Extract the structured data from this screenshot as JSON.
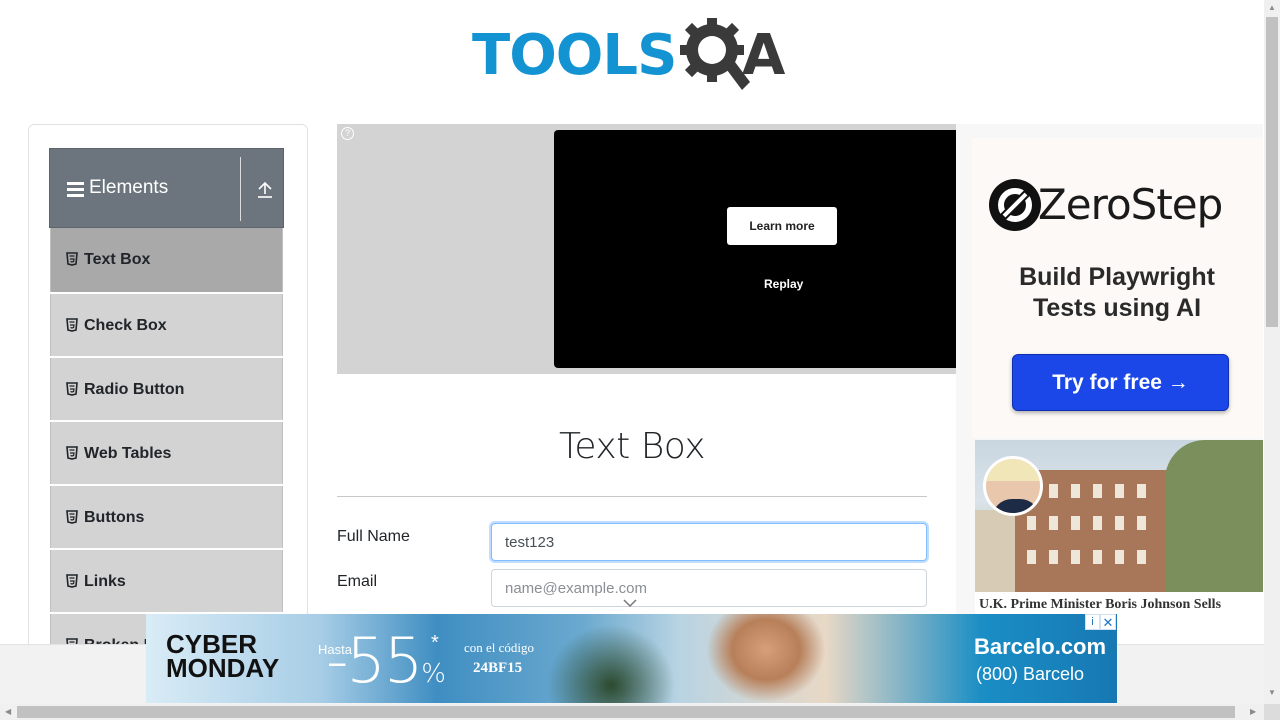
{
  "header": {
    "logo_text_left": "TOOLS",
    "logo_text_right": "A"
  },
  "sidebar": {
    "group_title": "Elements",
    "items": [
      {
        "label": "Text Box",
        "active": true
      },
      {
        "label": "Check Box",
        "active": false
      },
      {
        "label": "Radio Button",
        "active": false
      },
      {
        "label": "Web Tables",
        "active": false
      },
      {
        "label": "Buttons",
        "active": false
      },
      {
        "label": "Links",
        "active": false
      },
      {
        "label": "Broken Links - Images",
        "active": false
      }
    ]
  },
  "video_ad": {
    "learn_more": "Learn more",
    "replay": "Replay",
    "help": "?"
  },
  "main": {
    "title": "Text Box",
    "full_name_label": "Full Name",
    "full_name_value": "test123",
    "email_label": "Email",
    "email_placeholder": "name@example.com"
  },
  "right_ad": {
    "brand": "ZeroStep",
    "tagline": "Build Playwright Tests using AI",
    "cta": "Try for free →",
    "news_caption": "U.K. Prime Minister Boris Johnson Sells"
  },
  "bottom_ad": {
    "line1": "CYBER",
    "line2": "MONDAY",
    "hasta": "Hasta",
    "discount": "-55",
    "percent": "%",
    "star": "*",
    "code_label": "con el código",
    "code": "24BF15",
    "brand": "Barcelo.com",
    "phone": "(800) Barcelo",
    "close": "✕",
    "info": "i"
  },
  "colors": {
    "brand_blue": "#1493d2",
    "sidebar_header": "#6c757d",
    "sidebar_item": "#d3d3d3",
    "sidebar_item_active": "#a9a9a9",
    "cta_blue": "#1b47e8"
  }
}
